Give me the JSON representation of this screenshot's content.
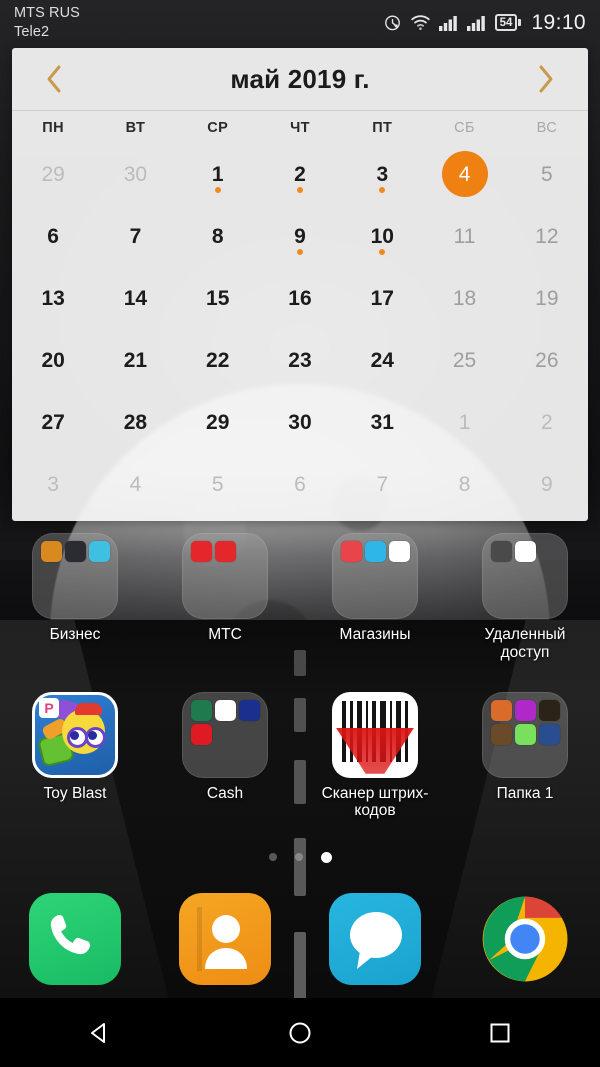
{
  "statusbar": {
    "carrier_primary": "MTS RUS",
    "carrier_secondary": "Tele2",
    "alarm_icon": "alarm-icon",
    "wifi_icon": "wifi-icon",
    "signal1_icon": "signal-bars-icon",
    "signal2_icon": "signal-bars-icon",
    "battery_level": "54",
    "clock": "19:10"
  },
  "calendar": {
    "title": "май 2019 г.",
    "prev_label": "‹",
    "next_label": "›",
    "weekdays": [
      {
        "label": "ПН",
        "weekend": false
      },
      {
        "label": "ВТ",
        "weekend": false
      },
      {
        "label": "СР",
        "weekend": false
      },
      {
        "label": "ЧТ",
        "weekend": false
      },
      {
        "label": "ПТ",
        "weekend": false
      },
      {
        "label": "СБ",
        "weekend": true
      },
      {
        "label": "ВС",
        "weekend": true
      }
    ],
    "accent_color": "#ef8012",
    "dot_color": "#ef8a21",
    "chevron_color": "#c99a4e",
    "days": [
      {
        "n": "29",
        "state": "out",
        "dot": false
      },
      {
        "n": "30",
        "state": "out",
        "dot": false
      },
      {
        "n": "1",
        "state": "normal",
        "dot": true
      },
      {
        "n": "2",
        "state": "normal",
        "dot": true
      },
      {
        "n": "3",
        "state": "normal",
        "dot": true
      },
      {
        "n": "4",
        "state": "today",
        "dot": false
      },
      {
        "n": "5",
        "state": "weekend",
        "dot": false
      },
      {
        "n": "6",
        "state": "normal",
        "dot": false
      },
      {
        "n": "7",
        "state": "normal",
        "dot": false
      },
      {
        "n": "8",
        "state": "normal",
        "dot": false
      },
      {
        "n": "9",
        "state": "normal",
        "dot": true
      },
      {
        "n": "10",
        "state": "normal",
        "dot": true
      },
      {
        "n": "11",
        "state": "weekend",
        "dot": false
      },
      {
        "n": "12",
        "state": "weekend",
        "dot": false
      },
      {
        "n": "13",
        "state": "normal",
        "dot": false
      },
      {
        "n": "14",
        "state": "normal",
        "dot": false
      },
      {
        "n": "15",
        "state": "normal",
        "dot": false
      },
      {
        "n": "16",
        "state": "normal",
        "dot": false
      },
      {
        "n": "17",
        "state": "normal",
        "dot": false
      },
      {
        "n": "18",
        "state": "weekend",
        "dot": false
      },
      {
        "n": "19",
        "state": "weekend",
        "dot": false
      },
      {
        "n": "20",
        "state": "normal",
        "dot": false
      },
      {
        "n": "21",
        "state": "normal",
        "dot": false
      },
      {
        "n": "22",
        "state": "normal",
        "dot": false
      },
      {
        "n": "23",
        "state": "normal",
        "dot": false
      },
      {
        "n": "24",
        "state": "normal",
        "dot": false
      },
      {
        "n": "25",
        "state": "weekend",
        "dot": false
      },
      {
        "n": "26",
        "state": "weekend",
        "dot": false
      },
      {
        "n": "27",
        "state": "normal",
        "dot": false
      },
      {
        "n": "28",
        "state": "normal",
        "dot": false
      },
      {
        "n": "29",
        "state": "normal",
        "dot": false
      },
      {
        "n": "30",
        "state": "normal",
        "dot": false
      },
      {
        "n": "31",
        "state": "normal",
        "dot": false
      },
      {
        "n": "1",
        "state": "out",
        "dot": false
      },
      {
        "n": "2",
        "state": "out",
        "dot": false
      },
      {
        "n": "3",
        "state": "out",
        "dot": false
      },
      {
        "n": "4",
        "state": "out",
        "dot": false
      },
      {
        "n": "5",
        "state": "out",
        "dot": false
      },
      {
        "n": "6",
        "state": "out",
        "dot": false
      },
      {
        "n": "7",
        "state": "out",
        "dot": false
      },
      {
        "n": "8",
        "state": "out",
        "dot": false
      },
      {
        "n": "9",
        "state": "out",
        "dot": false
      }
    ]
  },
  "homescreen": {
    "row1": [
      {
        "label": "Бизнес",
        "type": "folder",
        "mini_colors": [
          "#d8891f",
          "#2b2b33",
          "#3fbfe2"
        ]
      },
      {
        "label": "МТС",
        "type": "folder",
        "mini_colors": [
          "#e3272a",
          "#e3272a"
        ]
      },
      {
        "label": "Магазины",
        "type": "folder",
        "mini_colors": [
          "#e8444a",
          "#2fb6e8",
          "#ffffff"
        ]
      },
      {
        "label": "Удаленный доступ",
        "type": "folder",
        "mini_colors": [
          "#4a4a4a",
          "#ffffff"
        ]
      }
    ],
    "row2": [
      {
        "label": "Toy Blast",
        "type": "app",
        "icon": "toy-blast-icon"
      },
      {
        "label": "Cash",
        "type": "folder",
        "mini_colors": [
          "#1f7a4d",
          "#ffffff",
          "#1b2f8f",
          "#e01a22"
        ]
      },
      {
        "label": "Сканер штрих-кодов",
        "type": "app",
        "icon": "barcode-scanner-icon"
      },
      {
        "label": "Папка 1",
        "type": "folder",
        "mini_colors": [
          "#d96c2a",
          "#b028c8",
          "#2b2218",
          "#6b4a2a",
          "#79e05e",
          "#2a4d8f"
        ]
      }
    ]
  },
  "pager": {
    "total": 3,
    "active_index": 2
  },
  "dock": [
    {
      "label": "Телефон",
      "icon": "phone-icon",
      "color": "#22c96a"
    },
    {
      "label": "Контакты",
      "icon": "contacts-icon",
      "color": "#f09418"
    },
    {
      "label": "Сообщения",
      "icon": "messages-icon",
      "color": "#1fabd6"
    },
    {
      "label": "Chrome",
      "icon": "chrome-icon",
      "color": "#4285f4"
    }
  ],
  "navbar": [
    {
      "label": "Назад",
      "icon": "back-triangle-icon"
    },
    {
      "label": "Главный экран",
      "icon": "home-circle-icon"
    },
    {
      "label": "Последние приложения",
      "icon": "recents-square-icon"
    }
  ]
}
